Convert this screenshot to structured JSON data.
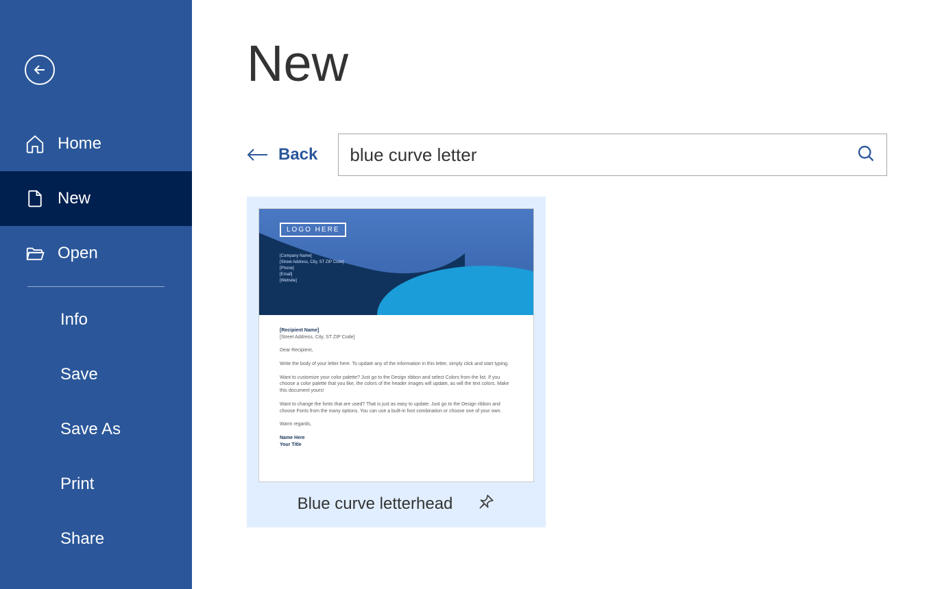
{
  "sidebar": {
    "items": [
      "Home",
      "New",
      "Open"
    ],
    "subitems": [
      "Info",
      "Save",
      "Save As",
      "Print",
      "Share"
    ],
    "selected": 1
  },
  "page": {
    "title": "New"
  },
  "search": {
    "back_label": "Back",
    "value": "blue curve letter"
  },
  "template": {
    "name": "Blue curve letterhead",
    "thumb": {
      "logo": "LOGO HERE",
      "company": [
        "[Company Name]",
        "[Street Address, City, ST ZIP Code]",
        "[Phone]",
        "[Email]",
        "[Website]"
      ],
      "recipient": [
        "[Recipient Name]",
        "[Street Address, City, ST ZIP Code]"
      ],
      "greeting": "Dear Recipient,",
      "p1": "Write the body of your letter here. To update any of the information in this letter, simply click and start typing.",
      "p2": "Want to customize your color palette? Just go to the Design ribbon and select Colors from the list. If you choose a color palette that you like, the colors of the header images will update, as will the text colors. Make this document yours!",
      "p3": "Want to change the fonts that are used? That is just as easy to update. Just go to the Design ribbon and choose Fonts from the many options. You can use a built-in font combination or choose one of your own.",
      "sign": "Warm regards,",
      "name": "Name Here",
      "title": "Your Title"
    }
  }
}
